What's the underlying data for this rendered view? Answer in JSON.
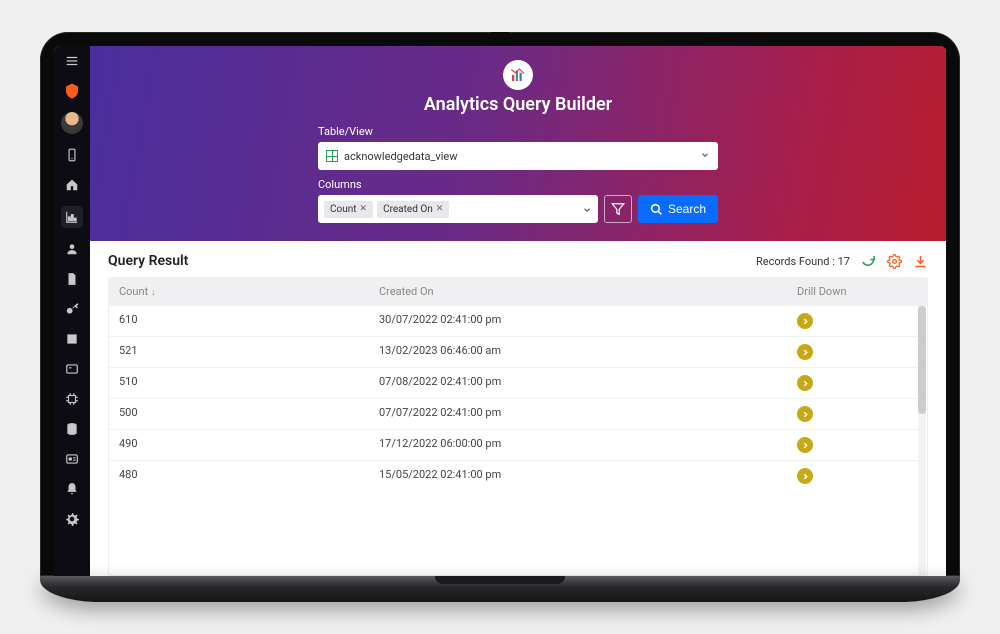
{
  "app": {
    "title": "Analytics Query Builder"
  },
  "sidebar": {
    "icons": [
      {
        "name": "menu-icon"
      },
      {
        "name": "shield-icon"
      },
      {
        "name": "avatar"
      },
      {
        "name": "mobile-icon"
      },
      {
        "name": "home-icon"
      },
      {
        "name": "chart-icon",
        "active": true
      },
      {
        "name": "user-icon"
      },
      {
        "name": "file-icon"
      },
      {
        "name": "key-icon"
      },
      {
        "name": "book-icon"
      },
      {
        "name": "card-icon"
      },
      {
        "name": "cpu-icon"
      },
      {
        "name": "database-icon"
      },
      {
        "name": "id-icon"
      },
      {
        "name": "bell-icon"
      },
      {
        "name": "gear-icon"
      }
    ]
  },
  "form": {
    "table_label": "Table/View",
    "table_value": "acknowledgedata_view",
    "columns_label": "Columns",
    "chips": [
      {
        "label": "Count"
      },
      {
        "label": "Created On"
      }
    ],
    "search_label": "Search"
  },
  "result": {
    "title": "Query Result",
    "records_label": "Records Found :",
    "records_count": "17",
    "columns": {
      "count": "Count",
      "created": "Created On",
      "drill": "Drill Down"
    },
    "rows": [
      {
        "count": "610",
        "created": "30/07/2022 02:41:00 pm"
      },
      {
        "count": "521",
        "created": "13/02/2023 06:46:00 am"
      },
      {
        "count": "510",
        "created": "07/08/2022 02:41:00 pm"
      },
      {
        "count": "500",
        "created": "07/07/2022 02:41:00 pm"
      },
      {
        "count": "490",
        "created": "17/12/2022 06:00:00 pm"
      },
      {
        "count": "480",
        "created": "15/05/2022 02:41:00 pm"
      }
    ]
  }
}
